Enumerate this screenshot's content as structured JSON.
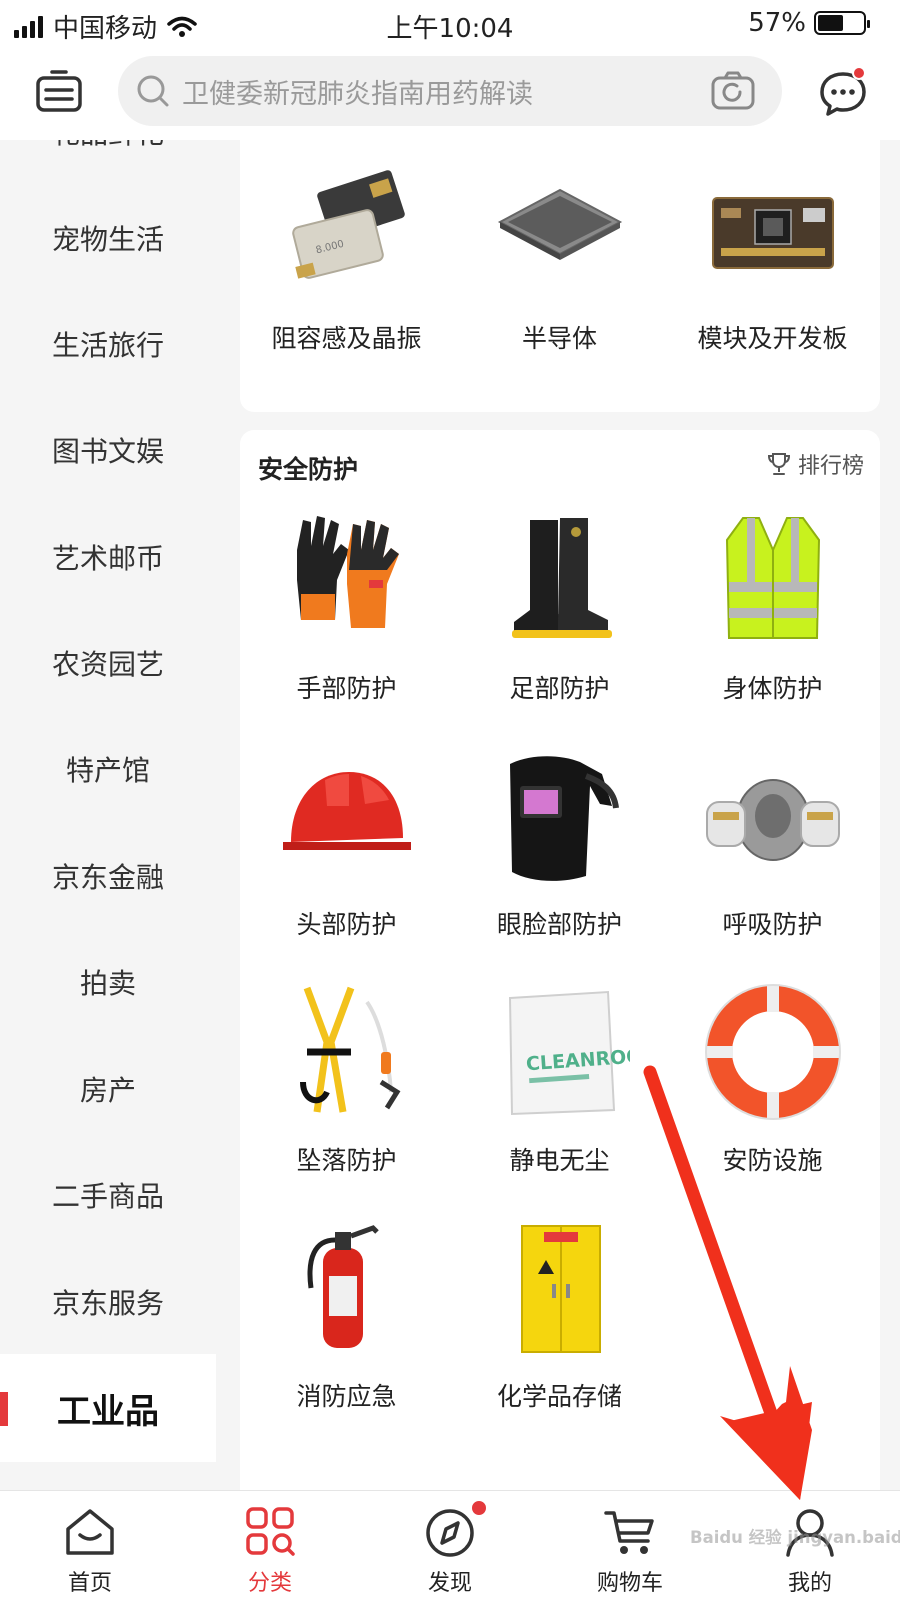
{
  "status_bar": {
    "carrier": "中国移动",
    "time": "上午10:04",
    "battery": "57%",
    "battery_level": 0.57
  },
  "header": {
    "search_placeholder": "卫健委新冠肺炎指南用药解读"
  },
  "sidebar": {
    "partial_top": "礼品鲜花",
    "items": [
      {
        "label": "宠物生活"
      },
      {
        "label": "生活旅行"
      },
      {
        "label": "图书文娱"
      },
      {
        "label": "艺术邮币"
      },
      {
        "label": "农资园艺"
      },
      {
        "label": "特产馆"
      },
      {
        "label": "京东金融"
      },
      {
        "label": "拍卖"
      },
      {
        "label": "房产"
      },
      {
        "label": "二手商品"
      },
      {
        "label": "京东服务"
      },
      {
        "label": "工业品"
      }
    ],
    "active_index": 11
  },
  "top_card": {
    "items": [
      {
        "label": "阻容感及晶振",
        "icon": "crystal-oscillator"
      },
      {
        "label": "半导体",
        "icon": "chip"
      },
      {
        "label": "模块及开发板",
        "icon": "dev-board"
      }
    ]
  },
  "safety_card": {
    "title": "安全防护",
    "rank_label": "排行榜",
    "items": [
      {
        "label": "手部防护",
        "icon": "gloves"
      },
      {
        "label": "足部防护",
        "icon": "boots"
      },
      {
        "label": "身体防护",
        "icon": "vest"
      },
      {
        "label": "头部防护",
        "icon": "helmet"
      },
      {
        "label": "眼脸部防护",
        "icon": "welding-mask"
      },
      {
        "label": "呼吸防护",
        "icon": "respirator"
      },
      {
        "label": "坠落防护",
        "icon": "harness"
      },
      {
        "label": "静电无尘",
        "icon": "cleanroom-wipers"
      },
      {
        "label": "安防设施",
        "icon": "lifebuoy"
      },
      {
        "label": "消防应急",
        "icon": "fire-extinguisher"
      },
      {
        "label": "化学品存储",
        "icon": "chemical-cabinet"
      }
    ],
    "wipers_package_text": "CLEANROOM"
  },
  "tab_bar": {
    "tabs": [
      {
        "label": "首页",
        "icon": "home-icon"
      },
      {
        "label": "分类",
        "icon": "category-icon"
      },
      {
        "label": "发现",
        "icon": "discover-icon"
      },
      {
        "label": "购物车",
        "icon": "cart-icon"
      },
      {
        "label": "我的",
        "icon": "profile-icon"
      }
    ],
    "active_index": 1
  },
  "watermark": "Baidu 经验 jingyan.baidu.com",
  "colors": {
    "accent": "#e4393c",
    "annotation_arrow": "#f0301c"
  }
}
